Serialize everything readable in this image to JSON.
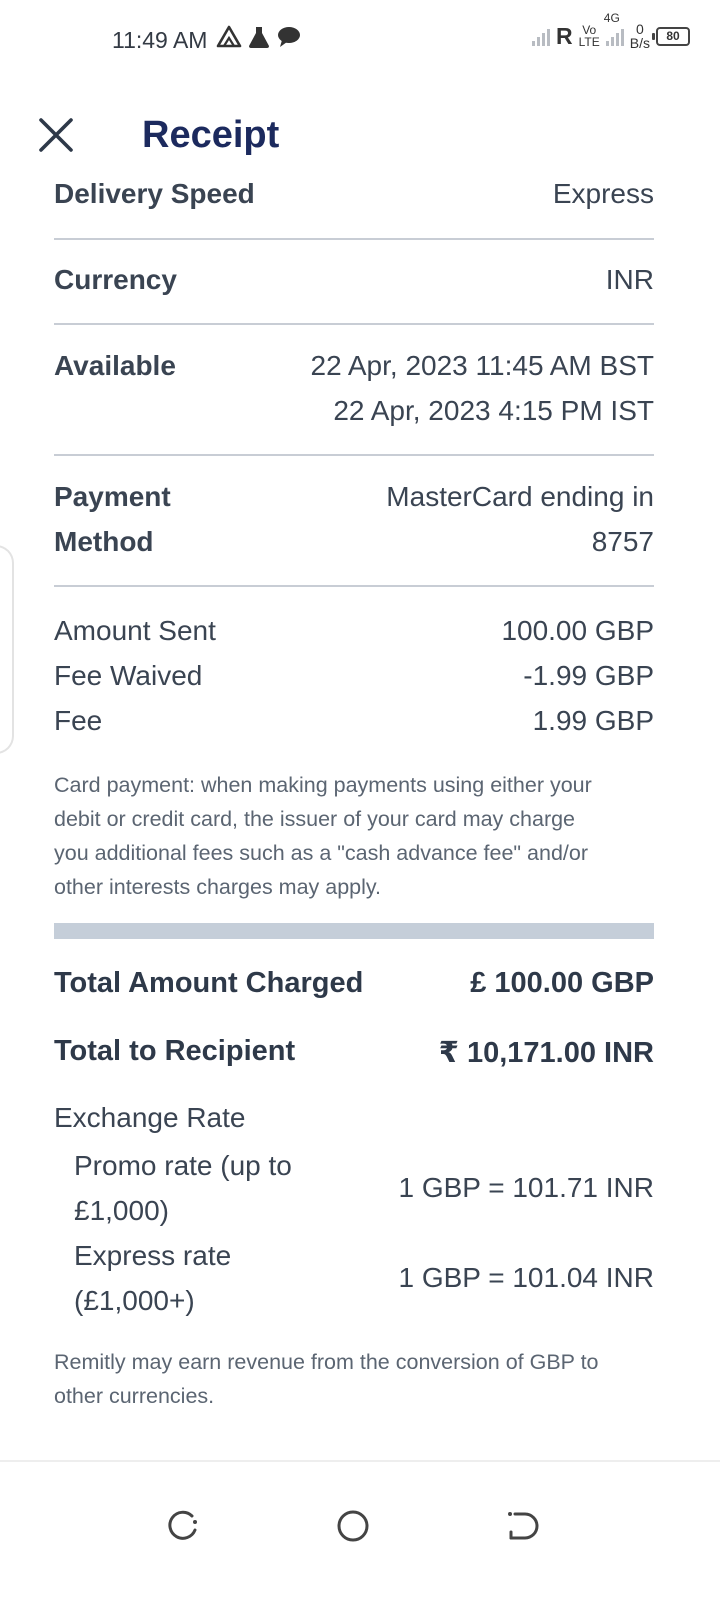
{
  "status_bar": {
    "time": "11:49 AM",
    "roaming": "R",
    "volte_top": "Vo",
    "volte_bottom": "LTE",
    "network": "4G",
    "speed_value": "0",
    "speed_unit": "B/s",
    "battery": "80"
  },
  "header": {
    "title": "Receipt",
    "close_icon": "close-icon"
  },
  "details": {
    "delivery_speed": {
      "label": "Delivery Speed",
      "value": "Express"
    },
    "currency": {
      "label": "Currency",
      "value": "INR"
    },
    "available": {
      "label": "Available",
      "value_line1": "22 Apr, 2023 11:45 AM BST",
      "value_line2": "22 Apr, 2023 4:15 PM IST"
    },
    "payment_method": {
      "label_line1": "Payment",
      "label_line2": "Method",
      "value_line1": "MasterCard ending in",
      "value_line2": "8757"
    }
  },
  "amounts": {
    "amount_sent": {
      "label": "Amount Sent",
      "value": "100.00 GBP"
    },
    "fee_waived": {
      "label": "Fee Waived",
      "value": "-1.99 GBP"
    },
    "fee": {
      "label": "Fee",
      "value": "1.99 GBP"
    }
  },
  "card_note": {
    "line1": "Card payment: when making payments using either your",
    "line2": "debit or credit card, the issuer of your card may charge",
    "line3": "you additional fees such as a \"cash advance fee\" and/or",
    "line4": "other interests charges may apply."
  },
  "totals": {
    "charged": {
      "label": "Total Amount Charged",
      "value": "£ 100.00 GBP"
    },
    "recipient": {
      "label": "Total to Recipient",
      "value": "₹ 10,171.00 INR"
    }
  },
  "exchange": {
    "title": "Exchange Rate",
    "promo": {
      "label_line1": "Promo rate (up to",
      "label_line2": "£1,000)",
      "value": "1 GBP = 101.71 INR"
    },
    "express": {
      "label_line1": "Express rate",
      "label_line2": "(£1,000+)",
      "value": "1 GBP = 101.04 INR"
    }
  },
  "revenue_note": {
    "line1": "Remitly may earn revenue from the conversion of GBP to",
    "line2": "other currencies."
  },
  "colors": {
    "title": "#1c2a5e",
    "text": "#3a4452",
    "divider": "#c8cdd5",
    "thick_bar": "#c5ced9"
  }
}
